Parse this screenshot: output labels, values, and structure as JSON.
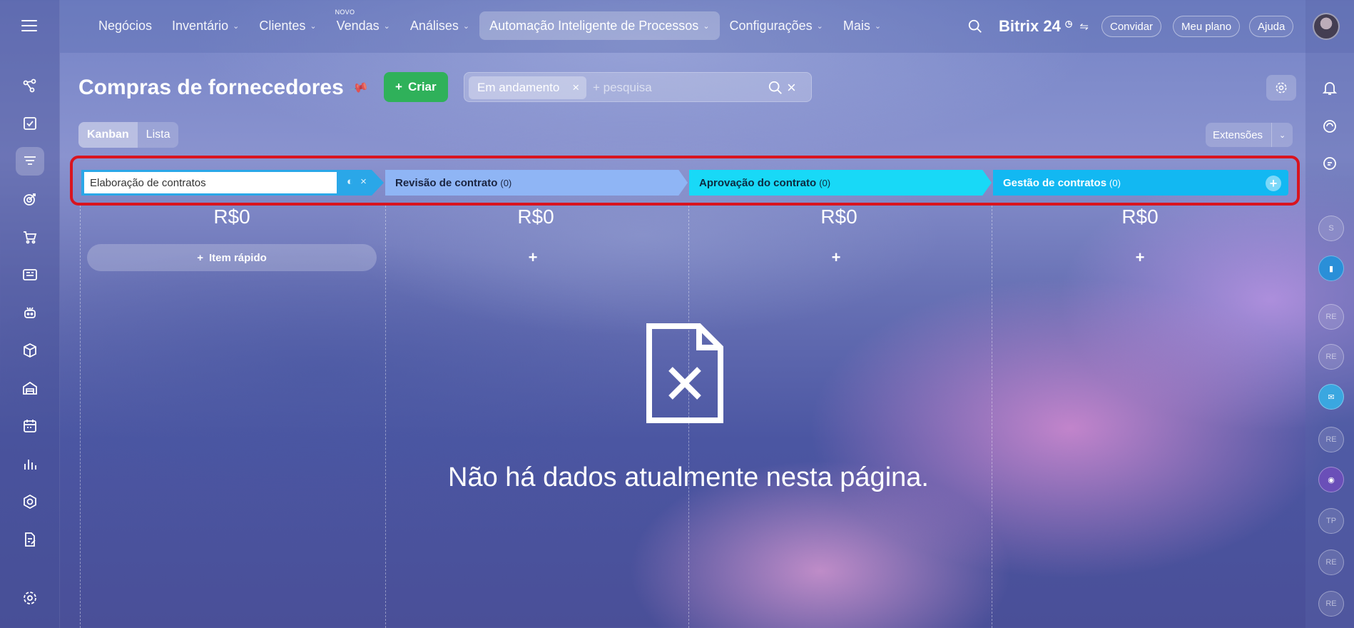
{
  "topbar": {
    "nav": [
      {
        "label": "Negócios",
        "chevron": false
      },
      {
        "label": "Inventário",
        "chevron": true
      },
      {
        "label": "Clientes",
        "chevron": true
      },
      {
        "label": "Vendas",
        "chevron": true,
        "badge": "NOVO"
      },
      {
        "label": "Análises",
        "chevron": true
      },
      {
        "label": "Automação Inteligente de Processos",
        "chevron": true,
        "active": true
      },
      {
        "label": "Configurações",
        "chevron": true
      },
      {
        "label": "Mais",
        "chevron": true
      }
    ],
    "brand": "Bitrix 24",
    "invite_label": "Convidar",
    "plan_label": "Meu plano",
    "help_label": "Ajuda"
  },
  "page": {
    "title": "Compras de fornecedores",
    "create_label": "Criar",
    "filter_chip": "Em andamento",
    "search_placeholder": "+ pesquisa",
    "view_kanban": "Kanban",
    "view_list": "Lista",
    "extensions_label": "Extensões"
  },
  "stages": [
    {
      "name": "Elaboração de contratos",
      "editing": true,
      "color": "#2aa7e8"
    },
    {
      "name": "Revisão de contrato",
      "count": "(0)",
      "color": "#8fb5f5"
    },
    {
      "name": "Aprovação do contrato",
      "count": "(0)",
      "color": "#18d9f7"
    },
    {
      "name": "Gestão de contratos",
      "count": "(0)",
      "color": "#12b8f2"
    }
  ],
  "columns": [
    {
      "sum": "R$0",
      "quick_label": "Item rápido"
    },
    {
      "sum": "R$0"
    },
    {
      "sum": "R$0"
    },
    {
      "sum": "R$0"
    }
  ],
  "empty_message": "Não há dados atualmente nesta página.",
  "left_sidebar_icons": [
    "flow-icon",
    "task-check-icon",
    "funnel-icon",
    "target-icon",
    "cart-icon",
    "news-icon",
    "robot-icon",
    "box-icon",
    "warehouse-icon",
    "calendar-icon",
    "chart-icon",
    "hexagon-icon",
    "document-sign-icon",
    "gear-icon"
  ],
  "right_sidebar_avatars": [
    "S",
    "RE",
    "RE",
    "RE",
    "TP",
    "RE",
    "RE"
  ],
  "colors": {
    "create": "#2fb15a",
    "highlight": "#d9141f"
  }
}
